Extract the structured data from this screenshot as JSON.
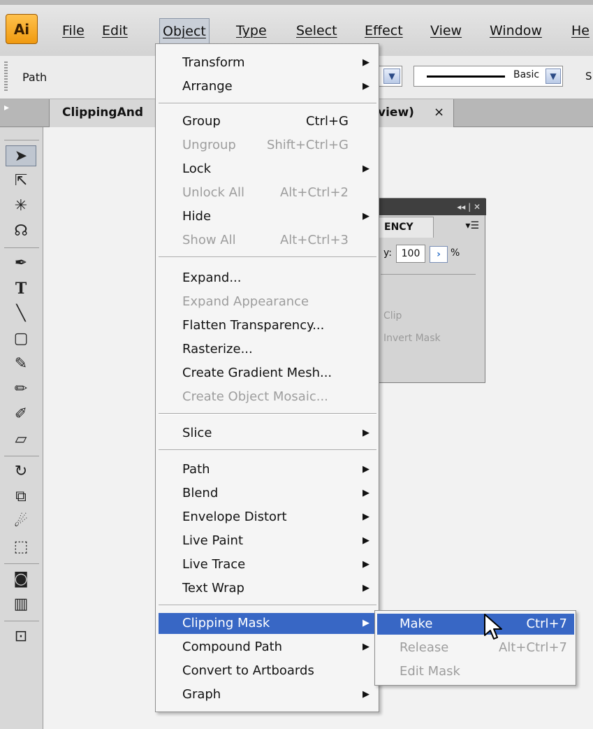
{
  "app": {
    "logo": "Ai"
  },
  "menubar": {
    "items": [
      {
        "label": "File"
      },
      {
        "label": "Edit"
      },
      {
        "label": "Object"
      },
      {
        "label": "Type"
      },
      {
        "label": "Select"
      },
      {
        "label": "Effect"
      },
      {
        "label": "View"
      },
      {
        "label": "Window"
      },
      {
        "label": "He"
      }
    ]
  },
  "controlbar": {
    "selection_label": "Path",
    "stroke_style": "Basic",
    "cut_label": "S"
  },
  "tabbar": {
    "doc_title": "ClippingAnd",
    "doc_title_tail": "view)",
    "close": "×"
  },
  "panel": {
    "tab": "ENCY",
    "opacity_prefix": "y:",
    "opacity": "100",
    "percent": "%",
    "clip": "Clip",
    "invert_mask": "Invert Mask"
  },
  "object_menu": {
    "items": [
      {
        "label": "Transform",
        "submenu": true
      },
      {
        "label": "Arrange",
        "submenu": true
      },
      {
        "label": "Group",
        "shortcut": "Ctrl+G"
      },
      {
        "label": "Ungroup",
        "shortcut": "Shift+Ctrl+G",
        "disabled": true
      },
      {
        "label": "Lock",
        "submenu": true
      },
      {
        "label": "Unlock All",
        "shortcut": "Alt+Ctrl+2",
        "disabled": true
      },
      {
        "label": "Hide",
        "submenu": true
      },
      {
        "label": "Show All",
        "shortcut": "Alt+Ctrl+3",
        "disabled": true
      },
      {
        "label": "Expand..."
      },
      {
        "label": "Expand Appearance",
        "disabled": true
      },
      {
        "label": "Flatten Transparency..."
      },
      {
        "label": "Rasterize..."
      },
      {
        "label": "Create Gradient Mesh..."
      },
      {
        "label": "Create Object Mosaic...",
        "disabled": true
      },
      {
        "label": "Slice",
        "submenu": true
      },
      {
        "label": "Path",
        "submenu": true
      },
      {
        "label": "Blend",
        "submenu": true
      },
      {
        "label": "Envelope Distort",
        "submenu": true
      },
      {
        "label": "Live Paint",
        "submenu": true
      },
      {
        "label": "Live Trace",
        "submenu": true
      },
      {
        "label": "Text Wrap",
        "submenu": true
      },
      {
        "label": "Clipping Mask",
        "submenu": true,
        "highlighted": true
      },
      {
        "label": "Compound Path",
        "submenu": true
      },
      {
        "label": "Convert to Artboards"
      },
      {
        "label": "Graph",
        "submenu": true
      }
    ]
  },
  "clipping_submenu": {
    "items": [
      {
        "label": "Make",
        "shortcut": "Ctrl+7",
        "highlighted": true
      },
      {
        "label": "Release",
        "shortcut": "Alt+Ctrl+7",
        "disabled": true
      },
      {
        "label": "Edit Mask",
        "disabled": true
      }
    ]
  },
  "colors": {
    "highlight": "#3867c5",
    "logo_orange": "#f09a10",
    "disabled_text": "#9d9d9d"
  }
}
